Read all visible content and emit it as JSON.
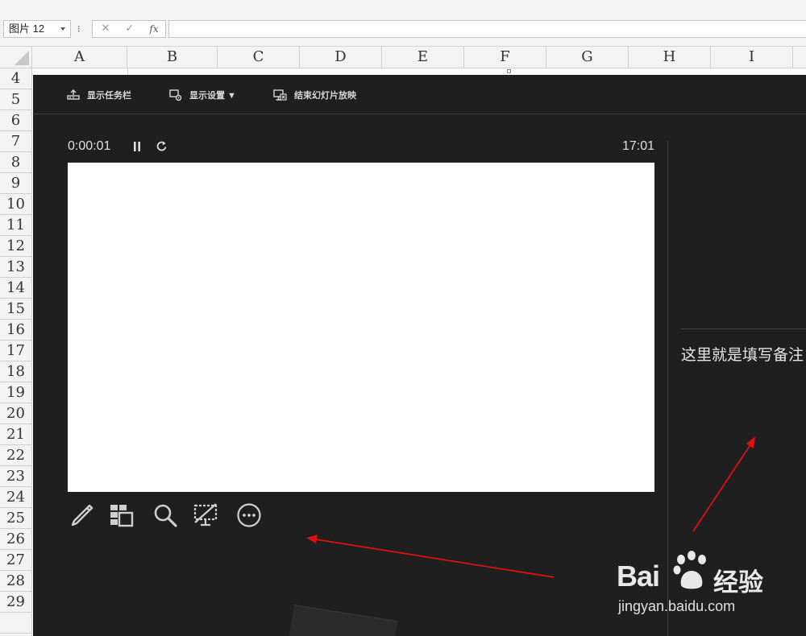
{
  "formula_bar": {
    "name_box": "图片 12",
    "separator": "⁝",
    "cancel_symbol": "✕",
    "enter_symbol": "✓",
    "fx_label": "fx",
    "formula": ""
  },
  "columns": [
    "A",
    "B",
    "C",
    "D",
    "E",
    "F",
    "G",
    "H",
    "I"
  ],
  "rows": [
    "4",
    "5",
    "6",
    "7",
    "8",
    "9",
    "10",
    "11",
    "12",
    "13",
    "14",
    "15",
    "16",
    "17",
    "18",
    "19",
    "20",
    "21",
    "22",
    "23",
    "24",
    "25",
    "26",
    "27",
    "28",
    "29"
  ],
  "presenter": {
    "toolbar": {
      "show_taskbar": "显示任务栏",
      "display_settings": "显示设置 ▼",
      "end_slideshow": "结束幻灯片放映"
    },
    "elapsed_time": "0:00:01",
    "clock": "17:01",
    "notes": "这里就是填写备注",
    "tools": [
      "pen-icon",
      "slides-grid-icon",
      "zoom-icon",
      "screen-off-icon",
      "more-icon"
    ]
  },
  "colors": {
    "presenter_bg": "#1f1f1f",
    "slide_bg": "#ffffff",
    "arrow": "#e01010",
    "sheet_header_bg": "#f3f3f3"
  },
  "watermark": {
    "brand": "Bai",
    "brand_suffix": "经验",
    "url": "jingyan.baidu.com"
  }
}
